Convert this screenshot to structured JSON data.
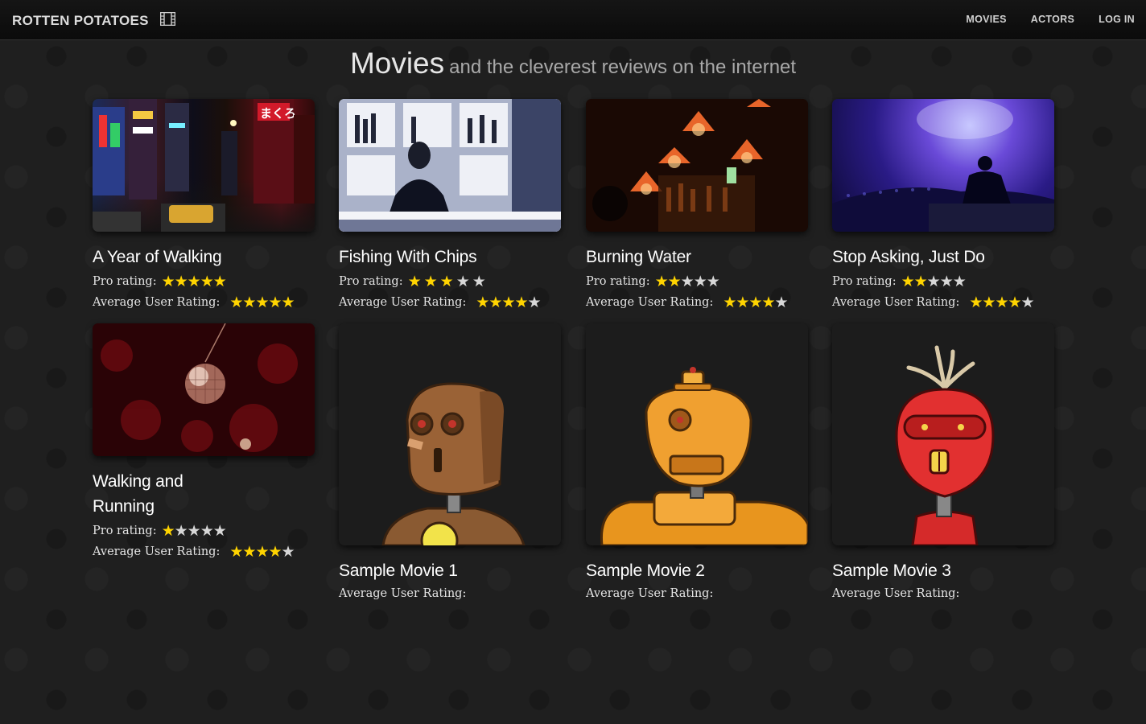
{
  "nav": {
    "brand": "ROTTEN POTATOES",
    "links": [
      "MOVIES",
      "ACTORS",
      "LOG IN"
    ]
  },
  "heading": {
    "title": "Movies",
    "subtitle": "and the cleverest reviews on the internet"
  },
  "labels": {
    "pro_rating": "Pro rating:",
    "user_rating": "Average User Rating:"
  },
  "colors": {
    "star": "#ffd400",
    "star_empty": "#d7d7d7",
    "background": "#1f1f1f"
  },
  "movies": [
    {
      "title": "A Year of Walking",
      "image": "city-night-street-photo",
      "pro_rating": 5,
      "user_rating": 5
    },
    {
      "title": "Fishing With Chips",
      "image": "bartender-photo",
      "pro_rating": 3,
      "user_rating": 4
    },
    {
      "title": "Burning Water",
      "image": "lamp-bar-photo",
      "pro_rating": 2,
      "user_rating": 4
    },
    {
      "title": "Stop Asking, Just Do",
      "image": "concert-dj-photo",
      "pro_rating": 2,
      "user_rating": 4
    },
    {
      "title": "Walking and Running",
      "image": "disco-ball-photo",
      "pro_rating": 1,
      "user_rating": 4
    },
    {
      "title": "Sample Movie 1",
      "image": "brown-robot-illustration",
      "pro_rating": null,
      "user_rating": null
    },
    {
      "title": "Sample Movie 2",
      "image": "orange-robot-illustration",
      "pro_rating": null,
      "user_rating": null
    },
    {
      "title": "Sample Movie 3",
      "image": "red-robot-illustration",
      "pro_rating": null,
      "user_rating": null
    }
  ]
}
